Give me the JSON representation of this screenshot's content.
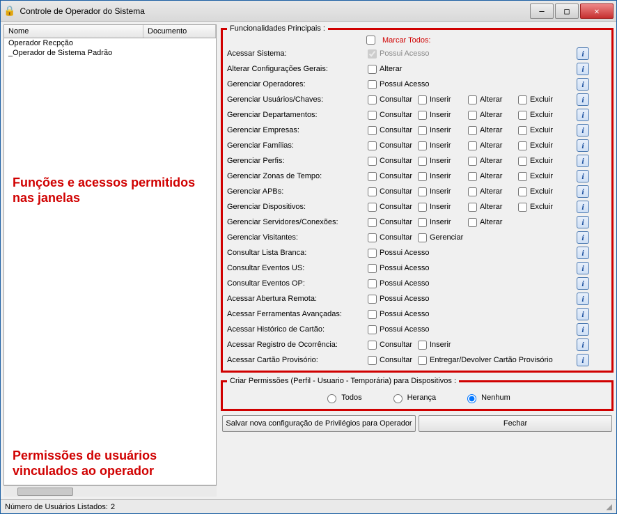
{
  "window": {
    "title": "Controle de Operador do Sistema"
  },
  "list": {
    "columns": {
      "nome": "Nome",
      "documento": "Documento"
    },
    "rows": [
      {
        "nome": "Operador Recpção",
        "documento": ""
      },
      {
        "nome": "_Operador de Sistema Padrão",
        "documento": ""
      }
    ]
  },
  "statusbar": {
    "usuarios_label": "Número de Usuários Listados:",
    "usuarios_count": "2"
  },
  "annotations": {
    "upper": "Funções e acessos permitidos nas janelas",
    "lower": "Permissões de usuários vinculados ao operador"
  },
  "fieldset_main": {
    "legend": "Funcionalidades Principais :",
    "marcar_todos": "Marcar Todos:",
    "labels": {
      "consultar": "Consultar",
      "inserir": "Inserir",
      "alterar": "Alterar",
      "excluir": "Excluir",
      "gerenciar": "Gerenciar",
      "possui_acesso": "Possui Acesso",
      "alterar_only": "Alterar",
      "entregar": "Entregar/Devolver Cartão Provisório"
    },
    "rows": {
      "r0": {
        "label": "Acessar Sistema:"
      },
      "r1": {
        "label": "Alterar Configurações Gerais:"
      },
      "r2": {
        "label": "Gerenciar Operadores:"
      },
      "r3": {
        "label": "Gerenciar Usuários/Chaves:"
      },
      "r4": {
        "label": "Gerenciar Departamentos:"
      },
      "r5": {
        "label": "Gerenciar Empresas:"
      },
      "r6": {
        "label": "Gerenciar Famílias:"
      },
      "r7": {
        "label": "Gerenciar Perfis:"
      },
      "r8": {
        "label": "Gerenciar Zonas de Tempo:"
      },
      "r9": {
        "label": "Gerenciar APBs:"
      },
      "r10": {
        "label": "Gerenciar Dispositivos:"
      },
      "r11": {
        "label": "Gerenciar Servidores/Conexões:"
      },
      "r12": {
        "label": "Gerenciar Visitantes:"
      },
      "r13": {
        "label": "Consultar Lista Branca:"
      },
      "r14": {
        "label": "Consultar Eventos US:"
      },
      "r15": {
        "label": "Consultar Eventos OP:"
      },
      "r16": {
        "label": "Acessar Abertura Remota:"
      },
      "r17": {
        "label": "Acessar Ferramentas Avançadas:"
      },
      "r18": {
        "label": "Acessar Histórico de Cartão:"
      },
      "r19": {
        "label": "Acessar Registro de Ocorrência:"
      },
      "r20": {
        "label": "Acessar Cartão Provisório:"
      }
    }
  },
  "fieldset_perm": {
    "legend": "Criar Permissões (Perfil - Usuario - Temporária)  para Dispositivos :",
    "options": {
      "todos": "Todos",
      "heranca": "Herança",
      "nenhum": "Nenhum"
    },
    "selected": "nenhum"
  },
  "buttons": {
    "salvar": "Salvar nova configuração de Privilégios para Operador",
    "fechar": "Fechar"
  }
}
